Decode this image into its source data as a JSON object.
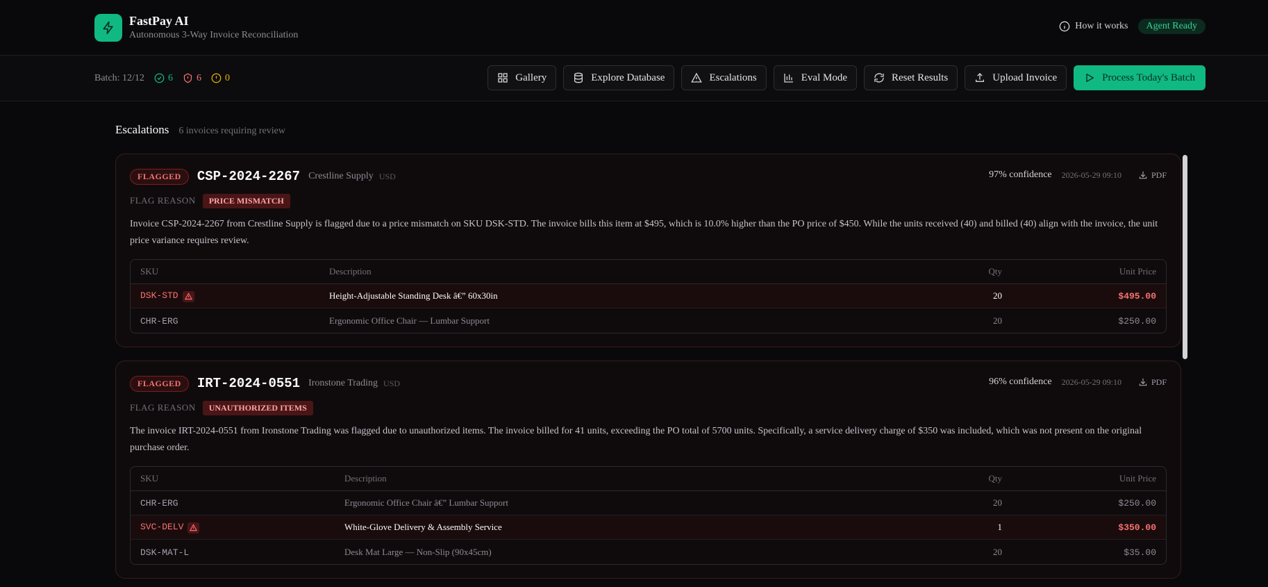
{
  "header": {
    "app_name": "FastPay AI",
    "subtitle": "Autonomous 3-Way Invoice Reconciliation",
    "how_it_works": "How it works",
    "agent_status": "Agent Ready"
  },
  "toolbar": {
    "batch": "Batch: 12/12",
    "approved_count": "6",
    "flagged_count": "6",
    "warning_count": "0",
    "buttons": {
      "gallery": "Gallery",
      "explore": "Explore Database",
      "escalations": "Escalations",
      "eval": "Eval Mode",
      "reset": "Reset Results",
      "upload": "Upload Invoice",
      "process": "Process Today's Batch"
    }
  },
  "escalations": {
    "title": "Escalations",
    "subtitle": "6 invoices requiring review"
  },
  "table_headers": {
    "sku": "SKU",
    "description": "Description",
    "qty": "Qty",
    "unit_price": "Unit Price"
  },
  "cards": [
    {
      "status": "FLAGGED",
      "invoice_id": "CSP-2024-2267",
      "vendor": "Crestline Supply",
      "currency": "USD",
      "confidence": "97% confidence",
      "timestamp": "2026-05-29 09:10",
      "pdf": "PDF",
      "flag_reason_label": "FLAG REASON",
      "flag_reason": "PRICE MISMATCH",
      "description": "Invoice CSP-2024-2267 from Crestline Supply is flagged due to a price mismatch on SKU DSK-STD. The invoice bills this item at $495, which is 10.0% higher than the PO price of $450. While the units received (40) and billed (40) align with the invoice, the unit price variance requires review.",
      "items": [
        {
          "sku": "DSK-STD",
          "description": "Height-Adjustable Standing Desk â€” 60x30in",
          "qty": "20",
          "price": "$495.00",
          "flagged": true
        },
        {
          "sku": "CHR-ERG",
          "description": "Ergonomic Office Chair — Lumbar Support",
          "qty": "20",
          "price": "$250.00",
          "flagged": false
        }
      ]
    },
    {
      "status": "FLAGGED",
      "invoice_id": "IRT-2024-0551",
      "vendor": "Ironstone Trading",
      "currency": "USD",
      "confidence": "96% confidence",
      "timestamp": "2026-05-29 09:10",
      "pdf": "PDF",
      "flag_reason_label": "FLAG REASON",
      "flag_reason": "UNAUTHORIZED ITEMS",
      "description": "The invoice IRT-2024-0551 from Ironstone Trading was flagged due to unauthorized items. The invoice billed for 41 units, exceeding the PO total of 5700 units. Specifically, a service delivery charge of $350 was included, which was not present on the original purchase order.",
      "items": [
        {
          "sku": "CHR-ERG",
          "description": "Ergonomic Office Chair â€” Lumbar Support",
          "qty": "20",
          "price": "$250.00",
          "flagged": false
        },
        {
          "sku": "SVC-DELV",
          "description": "White-Glove Delivery & Assembly Service",
          "qty": "1",
          "price": "$350.00",
          "flagged": true
        },
        {
          "sku": "DSK-MAT-L",
          "description": "Desk Mat Large — Non-Slip (90x45cm)",
          "qty": "20",
          "price": "$35.00",
          "flagged": false
        }
      ]
    }
  ]
}
